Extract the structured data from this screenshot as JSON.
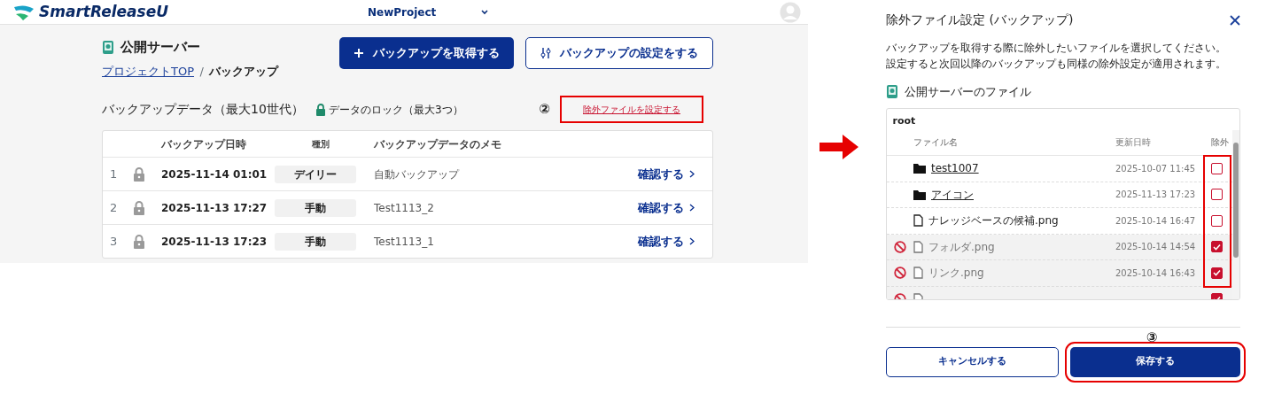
{
  "header": {
    "logo": "SmartReleaseU",
    "project": "NewProject"
  },
  "page": {
    "title": "公開サーバー",
    "breadcrumb": [
      {
        "label": "プロジェクトTOP",
        "kind": "link"
      },
      {
        "label": "/",
        "kind": "separator"
      },
      {
        "label": "バックアップ",
        "kind": "current"
      }
    ],
    "actions": [
      {
        "label": "バックアップを取得する",
        "kind": "primary"
      },
      {
        "label": "バックアップの設定をする",
        "kind": "outline"
      }
    ],
    "section": {
      "title": "バックアップデータ（最大10世代）",
      "lock_note": "データのロック（最大3つ）",
      "marker": "②",
      "exclude_link": "除外ファイルを設定する"
    },
    "table": {
      "columns": [
        "バックアップ日時",
        "種別",
        "バックアップデータのメモ"
      ],
      "rows": [
        {
          "index": "1",
          "datetime": "2025-11-14 01:01",
          "type": "デイリー",
          "memo": "自動バックアップ",
          "action": "確認する"
        },
        {
          "index": "2",
          "datetime": "2025-11-13 17:27",
          "type": "手動",
          "memo": "Test1113_2",
          "action": "確認する"
        },
        {
          "index": "3",
          "datetime": "2025-11-13 17:23",
          "type": "手動",
          "memo": "Test1113_1",
          "action": "確認する"
        }
      ]
    }
  },
  "dialog": {
    "title": "除外ファイル設定 (バックアップ)",
    "description": [
      "バックアップを取得する際に除外したいファイルを選択してください。",
      "設定すると次回以降のバックアップも同様の除外設定が適用されます。"
    ],
    "server_label": "公開サーバーのファイル",
    "tree_root": "root",
    "columns": [
      "ファイル名",
      "更新日時",
      "除外"
    ],
    "files": [
      {
        "kind": "folder",
        "name": "test1007",
        "updated": "2025-10-07 11:45",
        "checked": false
      },
      {
        "kind": "folder",
        "name": "アイコン",
        "updated": "2025-11-13 17:23",
        "checked": false
      },
      {
        "kind": "file",
        "name": "ナレッジベースの候補.png",
        "updated": "2025-10-14 16:47",
        "checked": false
      },
      {
        "kind": "file",
        "name": "フォルダ.png",
        "updated": "2025-10-14 14:54",
        "checked": true
      },
      {
        "kind": "file",
        "name": "リンク.png",
        "updated": "2025-10-14 16:43",
        "checked": true
      },
      {
        "kind": "file",
        "checked": true
      }
    ],
    "save_marker": "③",
    "buttons": [
      {
        "label": "キャンセルする",
        "kind": "outline"
      },
      {
        "label": "保存する",
        "kind": "primary"
      }
    ]
  }
}
